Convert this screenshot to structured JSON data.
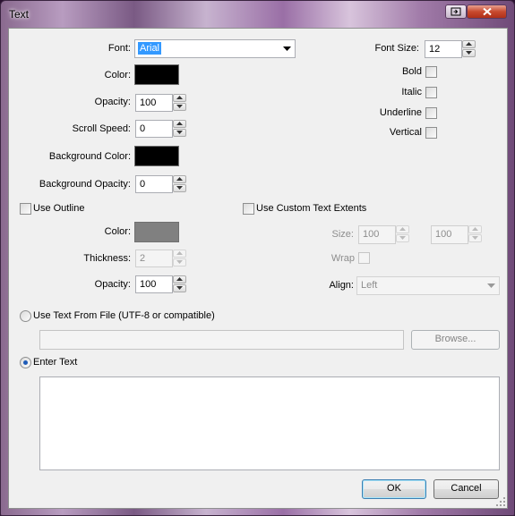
{
  "window": {
    "title": "Text"
  },
  "font": {
    "label": "Font:",
    "value": "Arial"
  },
  "color": {
    "label": "Color:",
    "swatch": "#000000"
  },
  "opacity": {
    "label": "Opacity:",
    "value": "100"
  },
  "scroll_speed": {
    "label": "Scroll Speed:",
    "value": "0"
  },
  "background_color": {
    "label": "Background Color:",
    "swatch": "#000000"
  },
  "background_opacity": {
    "label": "Background Opacity:",
    "value": "0"
  },
  "font_size": {
    "label": "Font Size:",
    "value": "12"
  },
  "styles": {
    "bold": "Bold",
    "italic": "Italic",
    "underline": "Underline",
    "vertical": "Vertical"
  },
  "outline": {
    "label": "Use Outline",
    "color_label": "Color:",
    "swatch": "#808080",
    "thickness_label": "Thickness:",
    "thickness": "2",
    "opacity_label": "Opacity:",
    "opacity": "100"
  },
  "extents": {
    "label": "Use Custom Text Extents",
    "size_label": "Size:",
    "width": "100",
    "height": "100",
    "wrap_label": "Wrap",
    "align_label": "Align:",
    "align": "Left"
  },
  "source": {
    "file_label": "Use Text From File (UTF-8 or compatible)",
    "file_path": "",
    "browse": "Browse...",
    "enter_label": "Enter Text",
    "text": ""
  },
  "buttons": {
    "ok": "OK",
    "cancel": "Cancel"
  }
}
